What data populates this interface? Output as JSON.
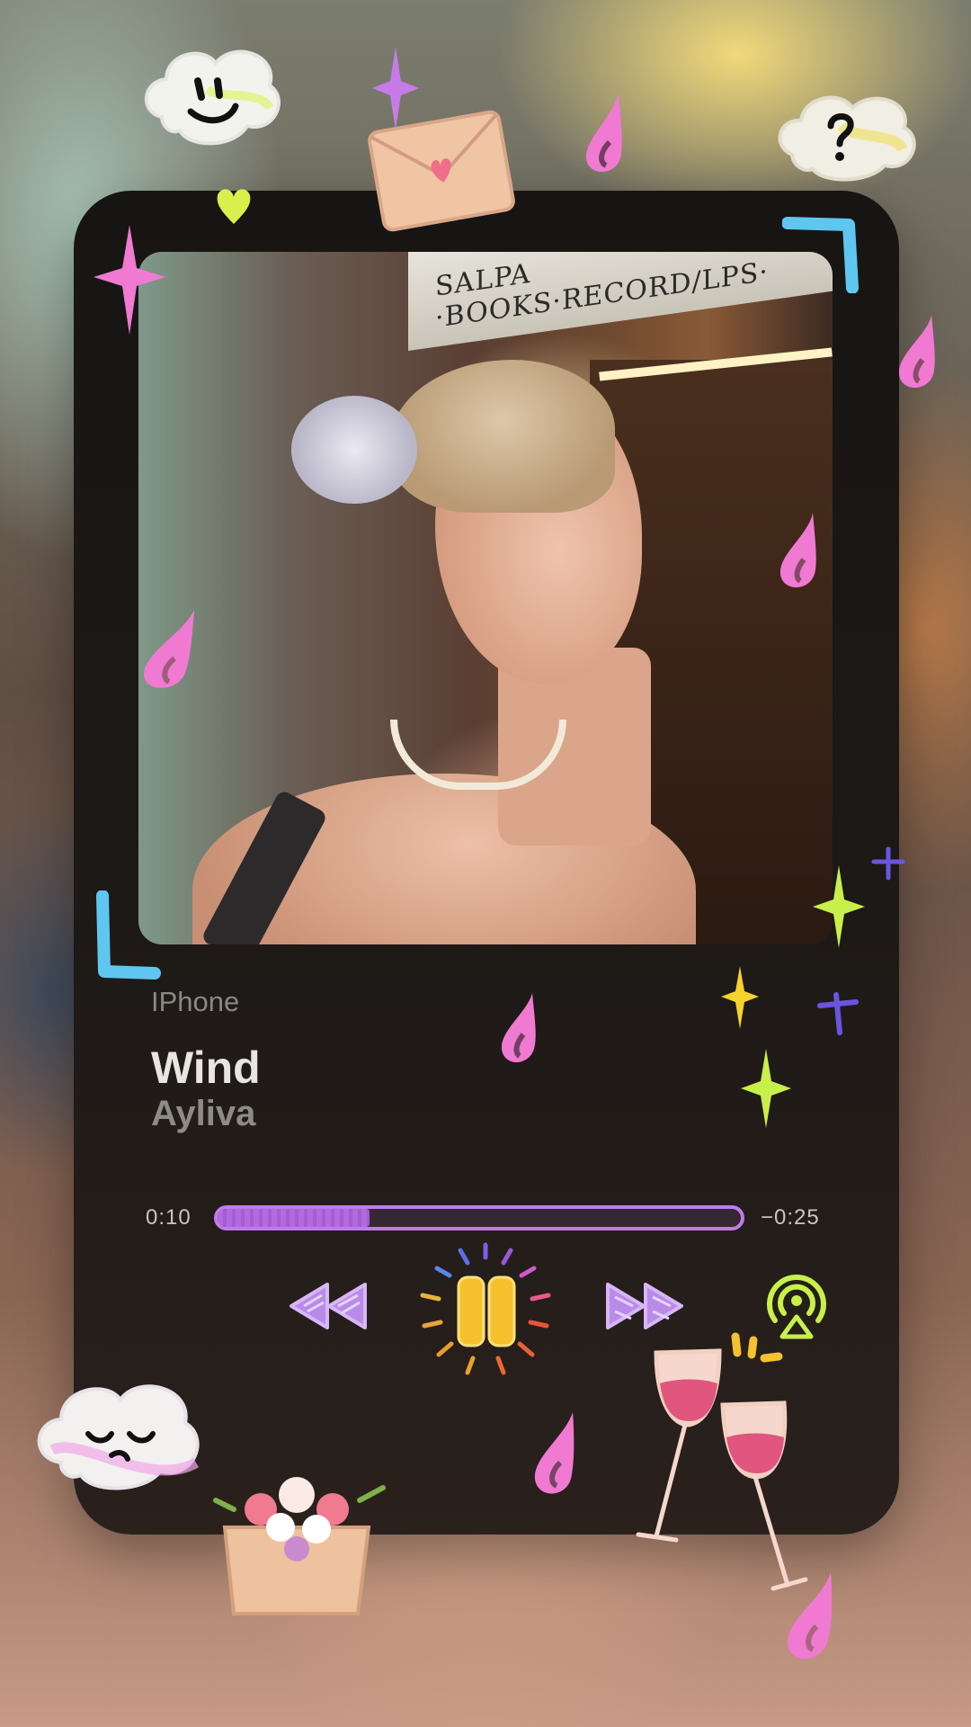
{
  "now_playing": {
    "device": "IPhone",
    "title": "Wind",
    "artist": "Ayliva"
  },
  "playback": {
    "elapsed": "0:10",
    "remaining": "−0:25",
    "progress_fraction": 0.29
  },
  "artwork": {
    "sign_text": "SALPA ·BOOKS·RECORD/LPS·"
  },
  "controls": {
    "rewind_icon": "rewind-icon",
    "play_pause_icon": "pause-icon",
    "forward_icon": "fast-forward-icon",
    "airplay_icon": "airplay-icon"
  },
  "colors": {
    "accent_purple": "#c07be8",
    "pause_yellow": "#f5c12e",
    "doodle_pink": "#f07ad2",
    "doodle_blue": "#5fc6f0",
    "doodle_lime": "#c8f04a"
  }
}
